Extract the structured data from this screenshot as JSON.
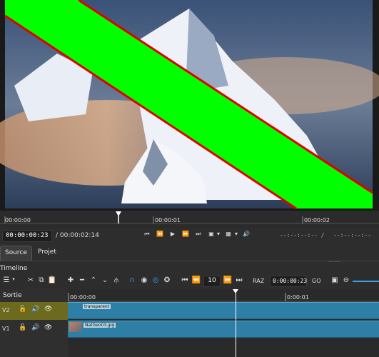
{
  "ruler": {
    "t0": "00:00:00",
    "t1": "00:00:01",
    "t2": "00:00:02"
  },
  "transport": {
    "current_timecode": "00:00:00:23",
    "total_duration": "/ 00:00:02:14",
    "in_point": "--:--:--:-- /",
    "out_point": "--:--:--:--"
  },
  "tabs": [
    {
      "label": "Source"
    },
    {
      "label": "Projet"
    }
  ],
  "timeline": {
    "title": "Timeline",
    "zoom_value": "10",
    "raz_label": "RAZ",
    "timecode": "0:00:00:23",
    "go_label": "GO",
    "output_label": "Sortie",
    "ruler": {
      "t0": "00:00:00",
      "t1": "0:00:01"
    },
    "tracks": [
      {
        "name": "V2",
        "clip": "transparent"
      },
      {
        "name": "V1",
        "clip": "NatGeo03.jpg"
      }
    ]
  },
  "colors": {
    "highlight_track": "#6b6a1e",
    "clip": "#2d7fa6",
    "accent": "#3aa0e8",
    "overlay_green": "#00ff00",
    "overlay_red": "#e00000"
  }
}
